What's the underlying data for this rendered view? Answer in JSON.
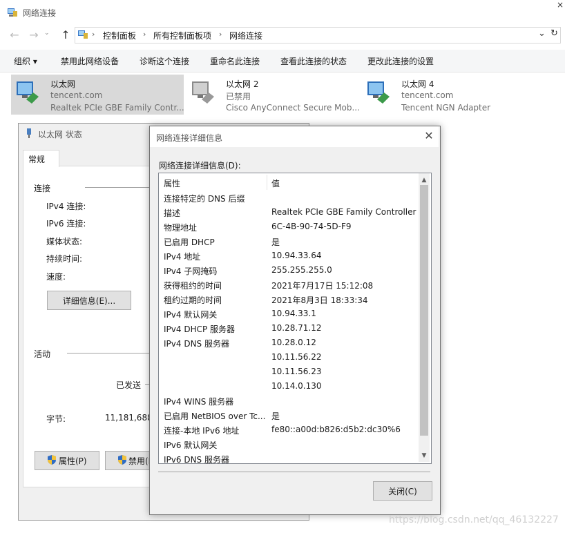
{
  "window": {
    "title": "网络连接"
  },
  "breadcrumb": [
    "控制面板",
    "所有控制面板项",
    "网络连接"
  ],
  "toolbar": {
    "organize": "组织 ▾",
    "disable": "禁用此网络设备",
    "diagnose": "诊断这个连接",
    "rename": "重命名此连接",
    "view_status": "查看此连接的状态",
    "change_settings": "更改此连接的设置"
  },
  "adapters": [
    {
      "name": "以太网",
      "status": "tencent.com",
      "device": "Realtek PCIe GBE Family Contr..."
    },
    {
      "name": "以太网 2",
      "status": "已禁用",
      "device": "Cisco AnyConnect Secure Mob..."
    },
    {
      "name": "以太网 4",
      "status": "tencent.com",
      "device": "Tencent NGN Adapter"
    }
  ],
  "status_dialog": {
    "title": "以太网 状态",
    "tab": "常规",
    "connection_heading": "连接",
    "ipv4": "IPv4 连接:",
    "ipv6": "IPv6 连接:",
    "media": "媒体状态:",
    "duration": "持续时间:",
    "speed": "速度:",
    "details_button": "详细信息(E)...",
    "activity_heading": "活动",
    "sent": "已发送",
    "bytes_label": "字节:",
    "bytes_value": "11,181,688,",
    "properties_button": "属性(P)",
    "disable_button": "禁用(I"
  },
  "detail_dialog": {
    "title": "网络连接详细信息",
    "label": "网络连接详细信息(D):",
    "col_property": "属性",
    "col_value": "值",
    "rows": [
      {
        "p": "连接特定的 DNS 后缀",
        "v": ""
      },
      {
        "p": "描述",
        "v": "Realtek PCIe GBE Family Controller"
      },
      {
        "p": "物理地址",
        "v": "6C-4B-90-74-5D-F9"
      },
      {
        "p": "已启用 DHCP",
        "v": "是"
      },
      {
        "p": "IPv4 地址",
        "v": "10.94.33.64"
      },
      {
        "p": "IPv4 子网掩码",
        "v": "255.255.255.0"
      },
      {
        "p": "获得租约的时间",
        "v": "2021年7月17日 15:12:08"
      },
      {
        "p": "租约过期的时间",
        "v": "2021年8月3日 18:33:34"
      },
      {
        "p": "IPv4 默认网关",
        "v": "10.94.33.1"
      },
      {
        "p": "IPv4 DHCP 服务器",
        "v": "10.28.71.12"
      },
      {
        "p": "IPv4 DNS 服务器",
        "v": "10.28.0.12"
      },
      {
        "p": "",
        "v": "10.11.56.22"
      },
      {
        "p": "",
        "v": "10.11.56.23"
      },
      {
        "p": "",
        "v": "10.14.0.130"
      },
      {
        "p": "IPv4 WINS 服务器",
        "v": ""
      },
      {
        "p": "已启用 NetBIOS over Tc...",
        "v": "是"
      },
      {
        "p": "连接-本地 IPv6 地址",
        "v": "fe80::a00d:b826:d5b2:dc30%6"
      },
      {
        "p": "IPv6 默认网关",
        "v": ""
      },
      {
        "p": "IPv6 DNS 服务器",
        "v": ""
      }
    ],
    "close_button": "关闭(C)"
  },
  "watermark": "https://blog.csdn.net/qq_46132227"
}
